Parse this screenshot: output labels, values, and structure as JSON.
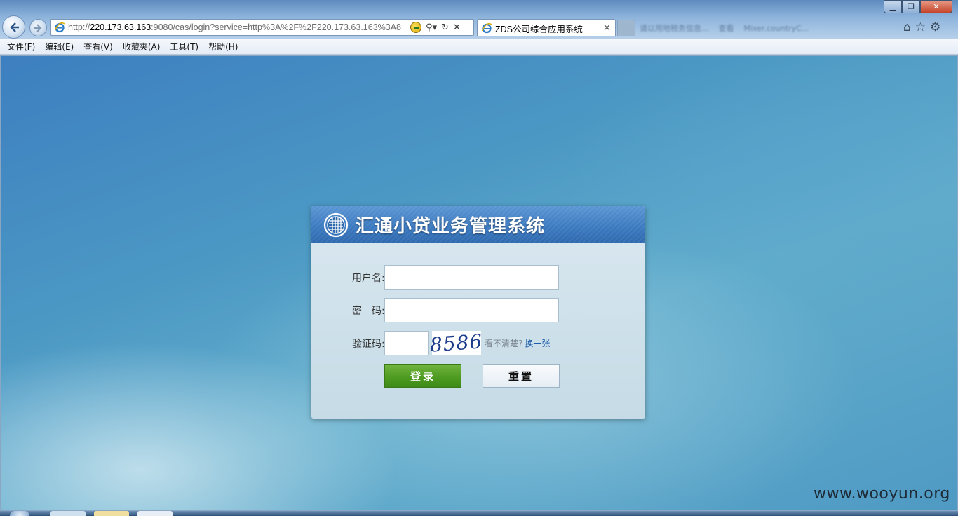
{
  "browser": {
    "url_prefix": "http://",
    "url_host": "220.173.63.163",
    "url_rest": ":9080/cas/login?service=http%3A%2F%2F220.173.63.163%3A8",
    "tab_title": "ZDS公司综合应用系统",
    "blurred_tabs": [
      "请以用地税务信息...",
      "查看",
      "Mixer.countryC..."
    ],
    "menu": [
      "文件(F)",
      "编辑(E)",
      "查看(V)",
      "收藏夹(A)",
      "工具(T)",
      "帮助(H)"
    ],
    "icons": [
      "back-icon",
      "forward-icon",
      "ie-logo-icon",
      "compat-view-icon",
      "search-icon",
      "refresh-icon",
      "stop-icon",
      "home-icon",
      "favorites-star-icon",
      "settings-gear-icon"
    ]
  },
  "login": {
    "system_title": "汇通小贷业务管理系统",
    "username_label": "用户名:",
    "username_value": "",
    "password_label": "密　码:",
    "password_value": "",
    "captcha_label": "验证码:",
    "captcha_value": "",
    "captcha_image_text": "8586",
    "captcha_hint": "看不清楚?",
    "captcha_refresh": "换一张",
    "login_button": "登录",
    "reset_button": "重置"
  },
  "watermark": "www.wooyun.org",
  "colors": {
    "header_blue": "#3a78bf",
    "login_green": "#4c9a1f",
    "background_blue": "#4b98c4",
    "link_blue": "#1a5aa8"
  }
}
